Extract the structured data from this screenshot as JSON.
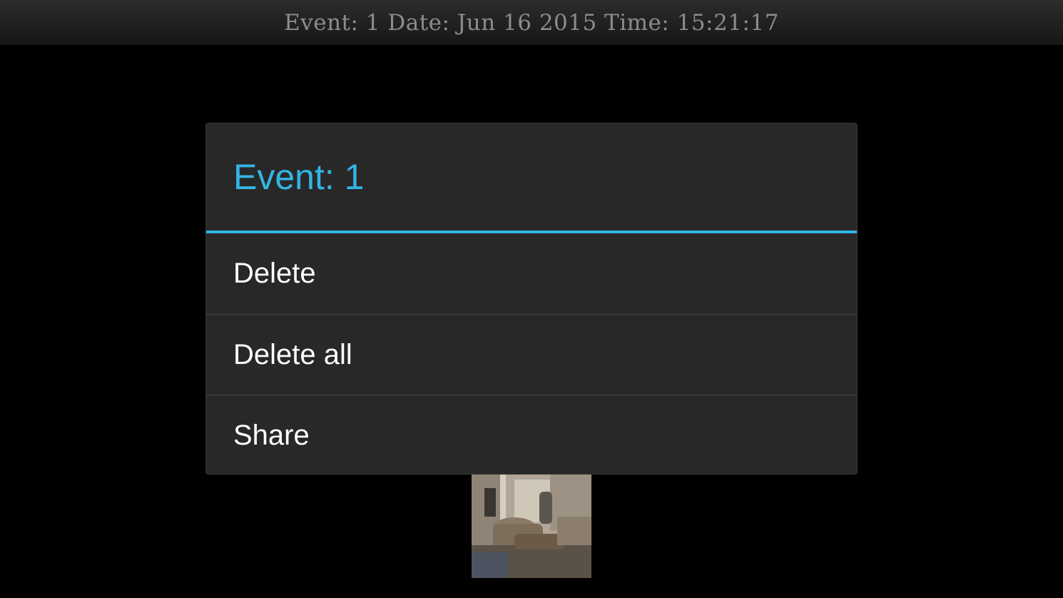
{
  "header": {
    "event_info": "Event: 1 Date: Jun 16 2015 Time: 15:21:17"
  },
  "dialog": {
    "title": "Event: 1",
    "items": [
      {
        "label": "Delete"
      },
      {
        "label": "Delete all"
      },
      {
        "label": "Share"
      }
    ]
  },
  "colors": {
    "accent": "#33b5e5",
    "dialog_bg": "#282828",
    "background": "#000000"
  }
}
